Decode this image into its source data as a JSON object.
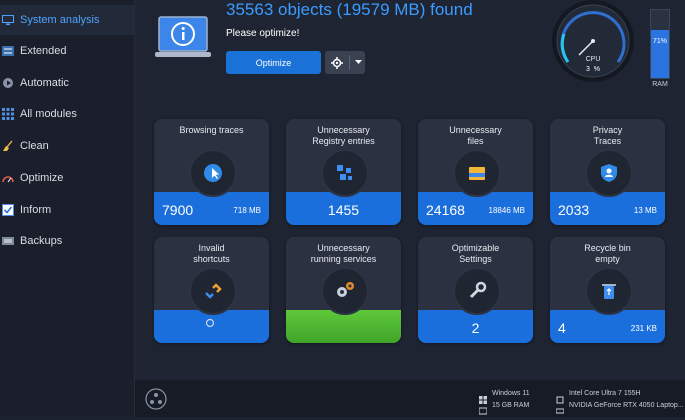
{
  "sidebar": {
    "items": [
      {
        "label": "System analysis",
        "icon": "monitor-icon",
        "active": true
      },
      {
        "label": "Extended",
        "icon": "sliders-icon",
        "active": false
      },
      {
        "label": "Automatic",
        "icon": "play-icon",
        "active": false
      },
      {
        "label": "All modules",
        "icon": "grid-icon",
        "active": false
      },
      {
        "label": "Clean",
        "icon": "broom-icon",
        "active": false
      },
      {
        "label": "Optimize",
        "icon": "speedometer-icon",
        "active": false
      },
      {
        "label": "Inform",
        "icon": "checkbox-icon",
        "active": false
      },
      {
        "label": "Backups",
        "icon": "backup-icon",
        "active": false
      }
    ]
  },
  "header": {
    "headline": "35563 objects (19579 MB) found",
    "subhead": "Please optimize!",
    "optimize_label": "Optimize"
  },
  "gauge": {
    "label": "CPU",
    "value": "3",
    "unit": "%"
  },
  "ram": {
    "percent_label": "71%",
    "label": "RAM",
    "level": 0.71
  },
  "cards": [
    {
      "title": "Browsing traces",
      "icon": "cursor-globe-icon",
      "count": "7900",
      "size": "718 MB",
      "band": "blue"
    },
    {
      "title": "Unnecessary\nRegistry entries",
      "icon": "registry-cubes-icon",
      "count": "1455",
      "size": "",
      "band": "blue"
    },
    {
      "title": "Unnecessary\nfiles",
      "icon": "folder-icon",
      "count": "24168",
      "size": "18846 MB",
      "band": "blue"
    },
    {
      "title": "Privacy\nTraces",
      "icon": "shield-icon",
      "count": "2033",
      "size": "13 MB",
      "band": "blue"
    },
    {
      "title": "Invalid\nshortcuts",
      "icon": "broken-link-icon",
      "count": "",
      "size": "",
      "band": "blue"
    },
    {
      "title": "Unnecessary\nrunning services",
      "icon": "gears-icon",
      "count": "",
      "size": "",
      "band": "green"
    },
    {
      "title": "Optimizable\nSettings",
      "icon": "wrench-icon",
      "count": "2",
      "size": "",
      "band": "blue"
    },
    {
      "title": "Recycle bin\nempty",
      "icon": "recycle-bin-icon",
      "count": "4",
      "size": "231 KB",
      "band": "blue"
    }
  ],
  "system": {
    "os": "Windows 11",
    "ram": "15 GB RAM",
    "cpu": "Intel Core Ultra 7 155H",
    "gpu": "NVIDIA GeForce RTX 4050 Laptop..."
  },
  "colors": {
    "accent": "#1a72d8",
    "headline": "#3b9cff",
    "green": "#4fb82f"
  }
}
